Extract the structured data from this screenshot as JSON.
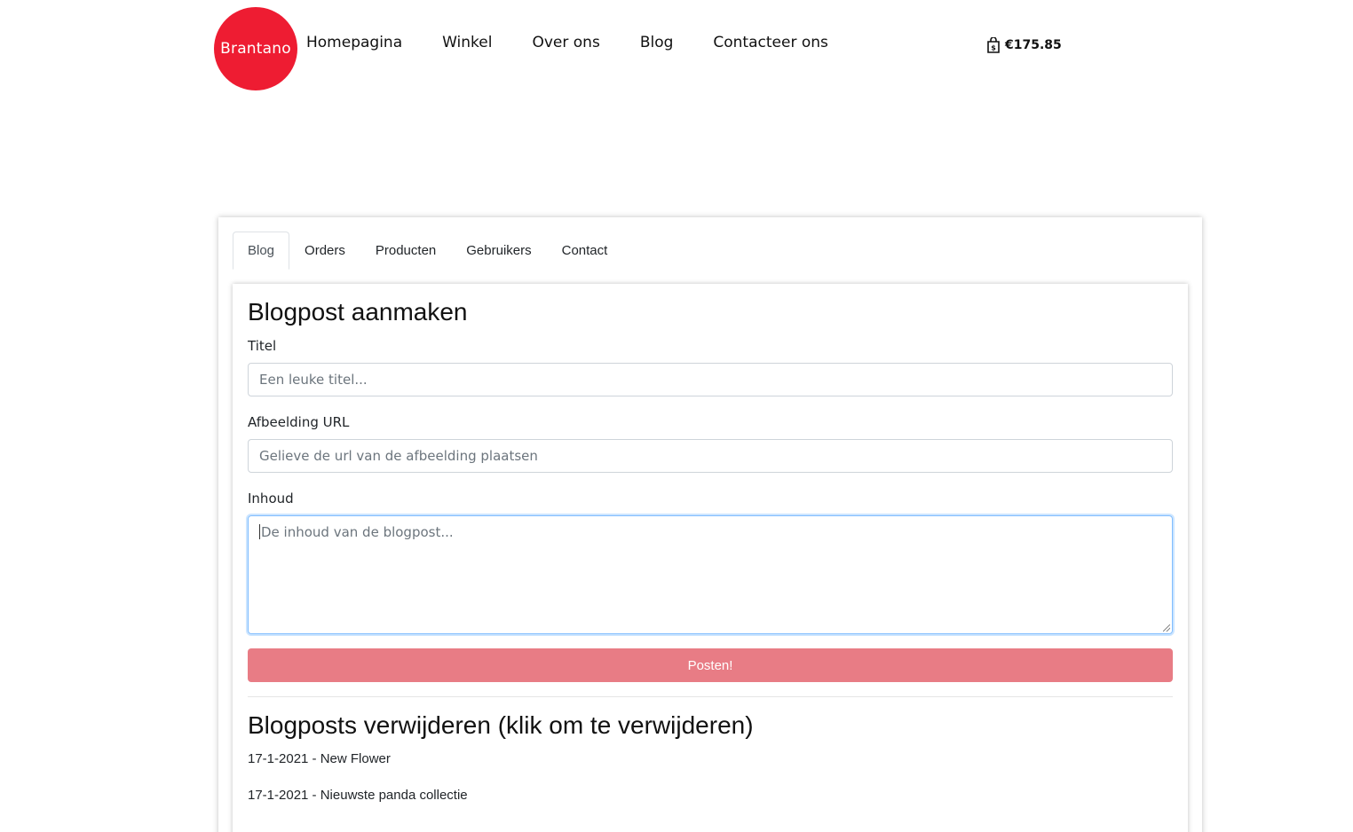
{
  "header": {
    "logo_text": "Brantano",
    "brand_color": "#ee1c32",
    "nav": [
      "Homepagina",
      "Winkel",
      "Over ons",
      "Blog",
      "Contacteer ons"
    ],
    "cart_icon": "shopping-bag-icon",
    "cart_total": "€175.85"
  },
  "admin": {
    "tabs": [
      "Blog",
      "Orders",
      "Producten",
      "Gebruikers",
      "Contact"
    ],
    "active_tab": "Blog",
    "create": {
      "heading": "Blogpost aanmaken",
      "title_label": "Titel",
      "title_placeholder": "Een leuke titel...",
      "image_label": "Afbeelding URL",
      "image_placeholder": "Gelieve de url van de afbeelding plaatsen",
      "content_label": "Inhoud",
      "content_placeholder": "De inhoud van de blogpost...",
      "submit_label": "Posten!",
      "submit_color": "#e87c85"
    },
    "delete": {
      "heading": "Blogposts verwijderen (klik om te verwijderen)",
      "posts": [
        "17-1-2021 - New Flower",
        "17-1-2021 - Nieuwste panda collectie"
      ]
    }
  }
}
